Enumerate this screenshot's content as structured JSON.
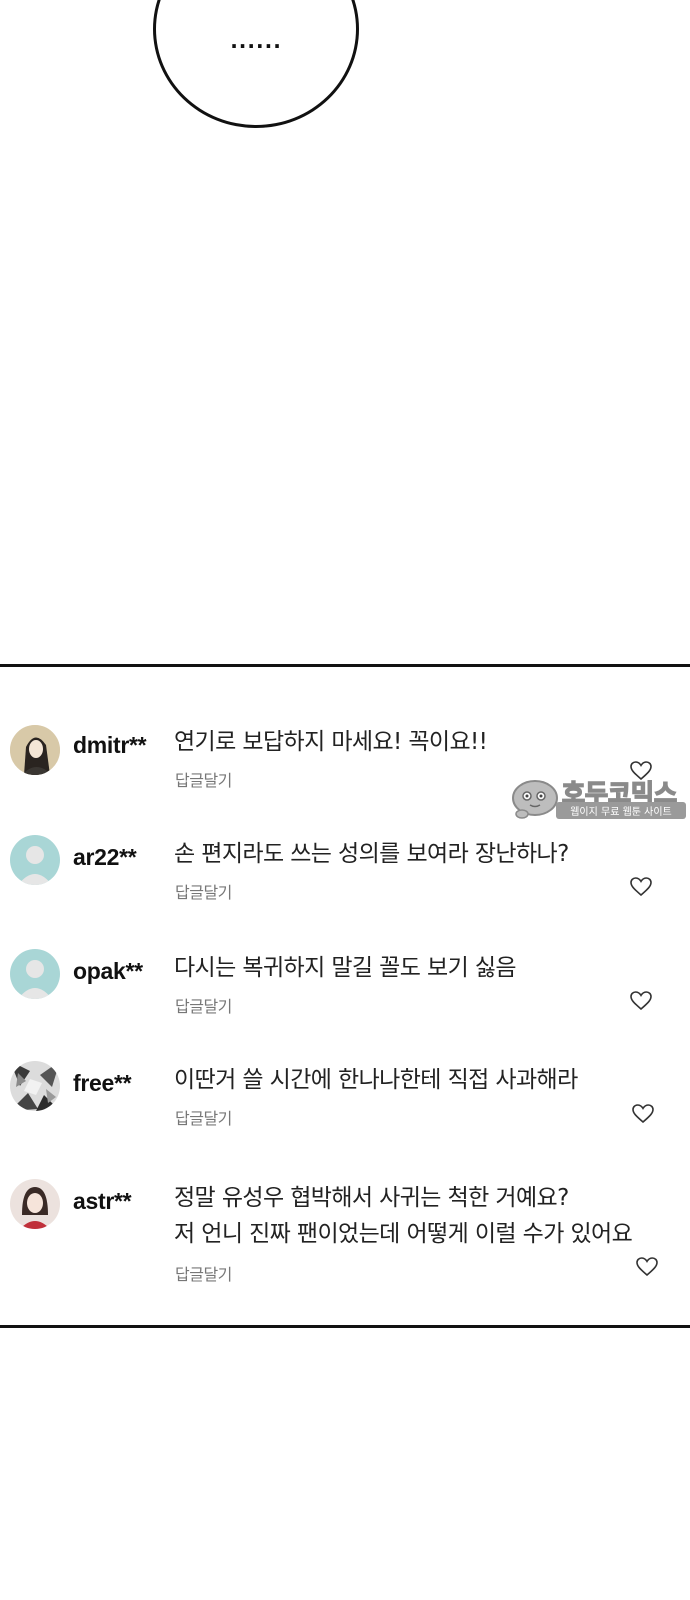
{
  "bubble": {
    "text": "......"
  },
  "comments": [
    {
      "username": "dmitr**",
      "lines": [
        "연기로 보답하지 마세요! 꼭이요!!"
      ],
      "reply_label": "답글달기",
      "avatar": "portrait-dark-hair"
    },
    {
      "username": "ar22**",
      "lines": [
        "손 편지라도 쓰는 성의를 보여라 장난하나?"
      ],
      "reply_label": "답글달기",
      "avatar": "default-avatar"
    },
    {
      "username": "opak**",
      "lines": [
        "다시는 복귀하지 말길 꼴도 보기 싫음"
      ],
      "reply_label": "답글달기",
      "avatar": "default-avatar"
    },
    {
      "username": "free**",
      "lines": [
        "이딴거 쓸 시간에 한나나한테 직접 사과해라"
      ],
      "reply_label": "답글달기",
      "avatar": "abstract-pattern"
    },
    {
      "username": "astr**",
      "lines": [
        "정말 유성우 협박해서 사귀는 척한 거예요?",
        "저 언니 진짜 팬이었는데 어떻게 이럴 수가 있어요"
      ],
      "reply_label": "답글달기",
      "avatar": "portrait-red-top"
    }
  ],
  "watermark": {
    "title": "호두코믹스",
    "subtitle": "웹이지 무료 웹툰 사이트"
  },
  "colors": {
    "default_avatar_bg": "#a9d6d6",
    "reply_text": "#777777",
    "border": "#111111"
  }
}
